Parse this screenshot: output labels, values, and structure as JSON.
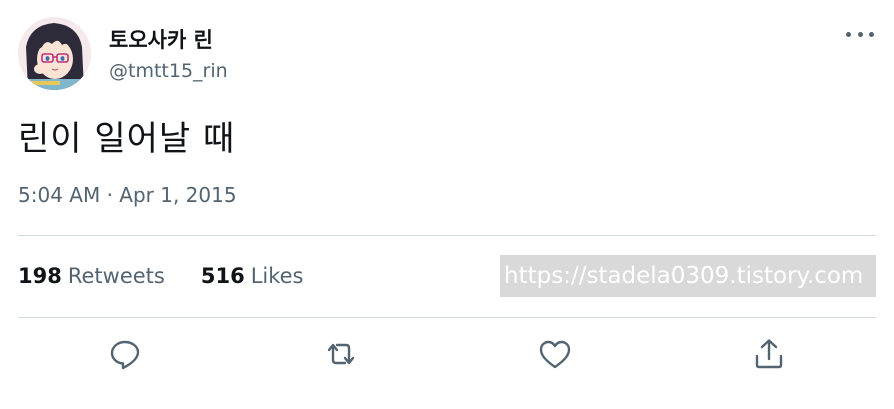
{
  "user": {
    "display_name": "토오사카 린",
    "handle": "@tmtt15_rin"
  },
  "tweet": {
    "text": "린이 일어날 때",
    "timestamp": "5:04 AM · Apr 1, 2015"
  },
  "stats": {
    "retweets_count": "198",
    "retweets_label": "Retweets",
    "likes_count": "516",
    "likes_label": "Likes"
  },
  "watermark": {
    "text": "https://stadela0309.tistory.com"
  },
  "icons": {
    "more": "more-icon",
    "reply": "reply-icon",
    "retweet": "retweet-icon",
    "like": "like-icon",
    "share": "share-icon"
  },
  "colors": {
    "text_primary": "#0f1419",
    "text_secondary": "#536471",
    "divider": "#cfd9de"
  }
}
